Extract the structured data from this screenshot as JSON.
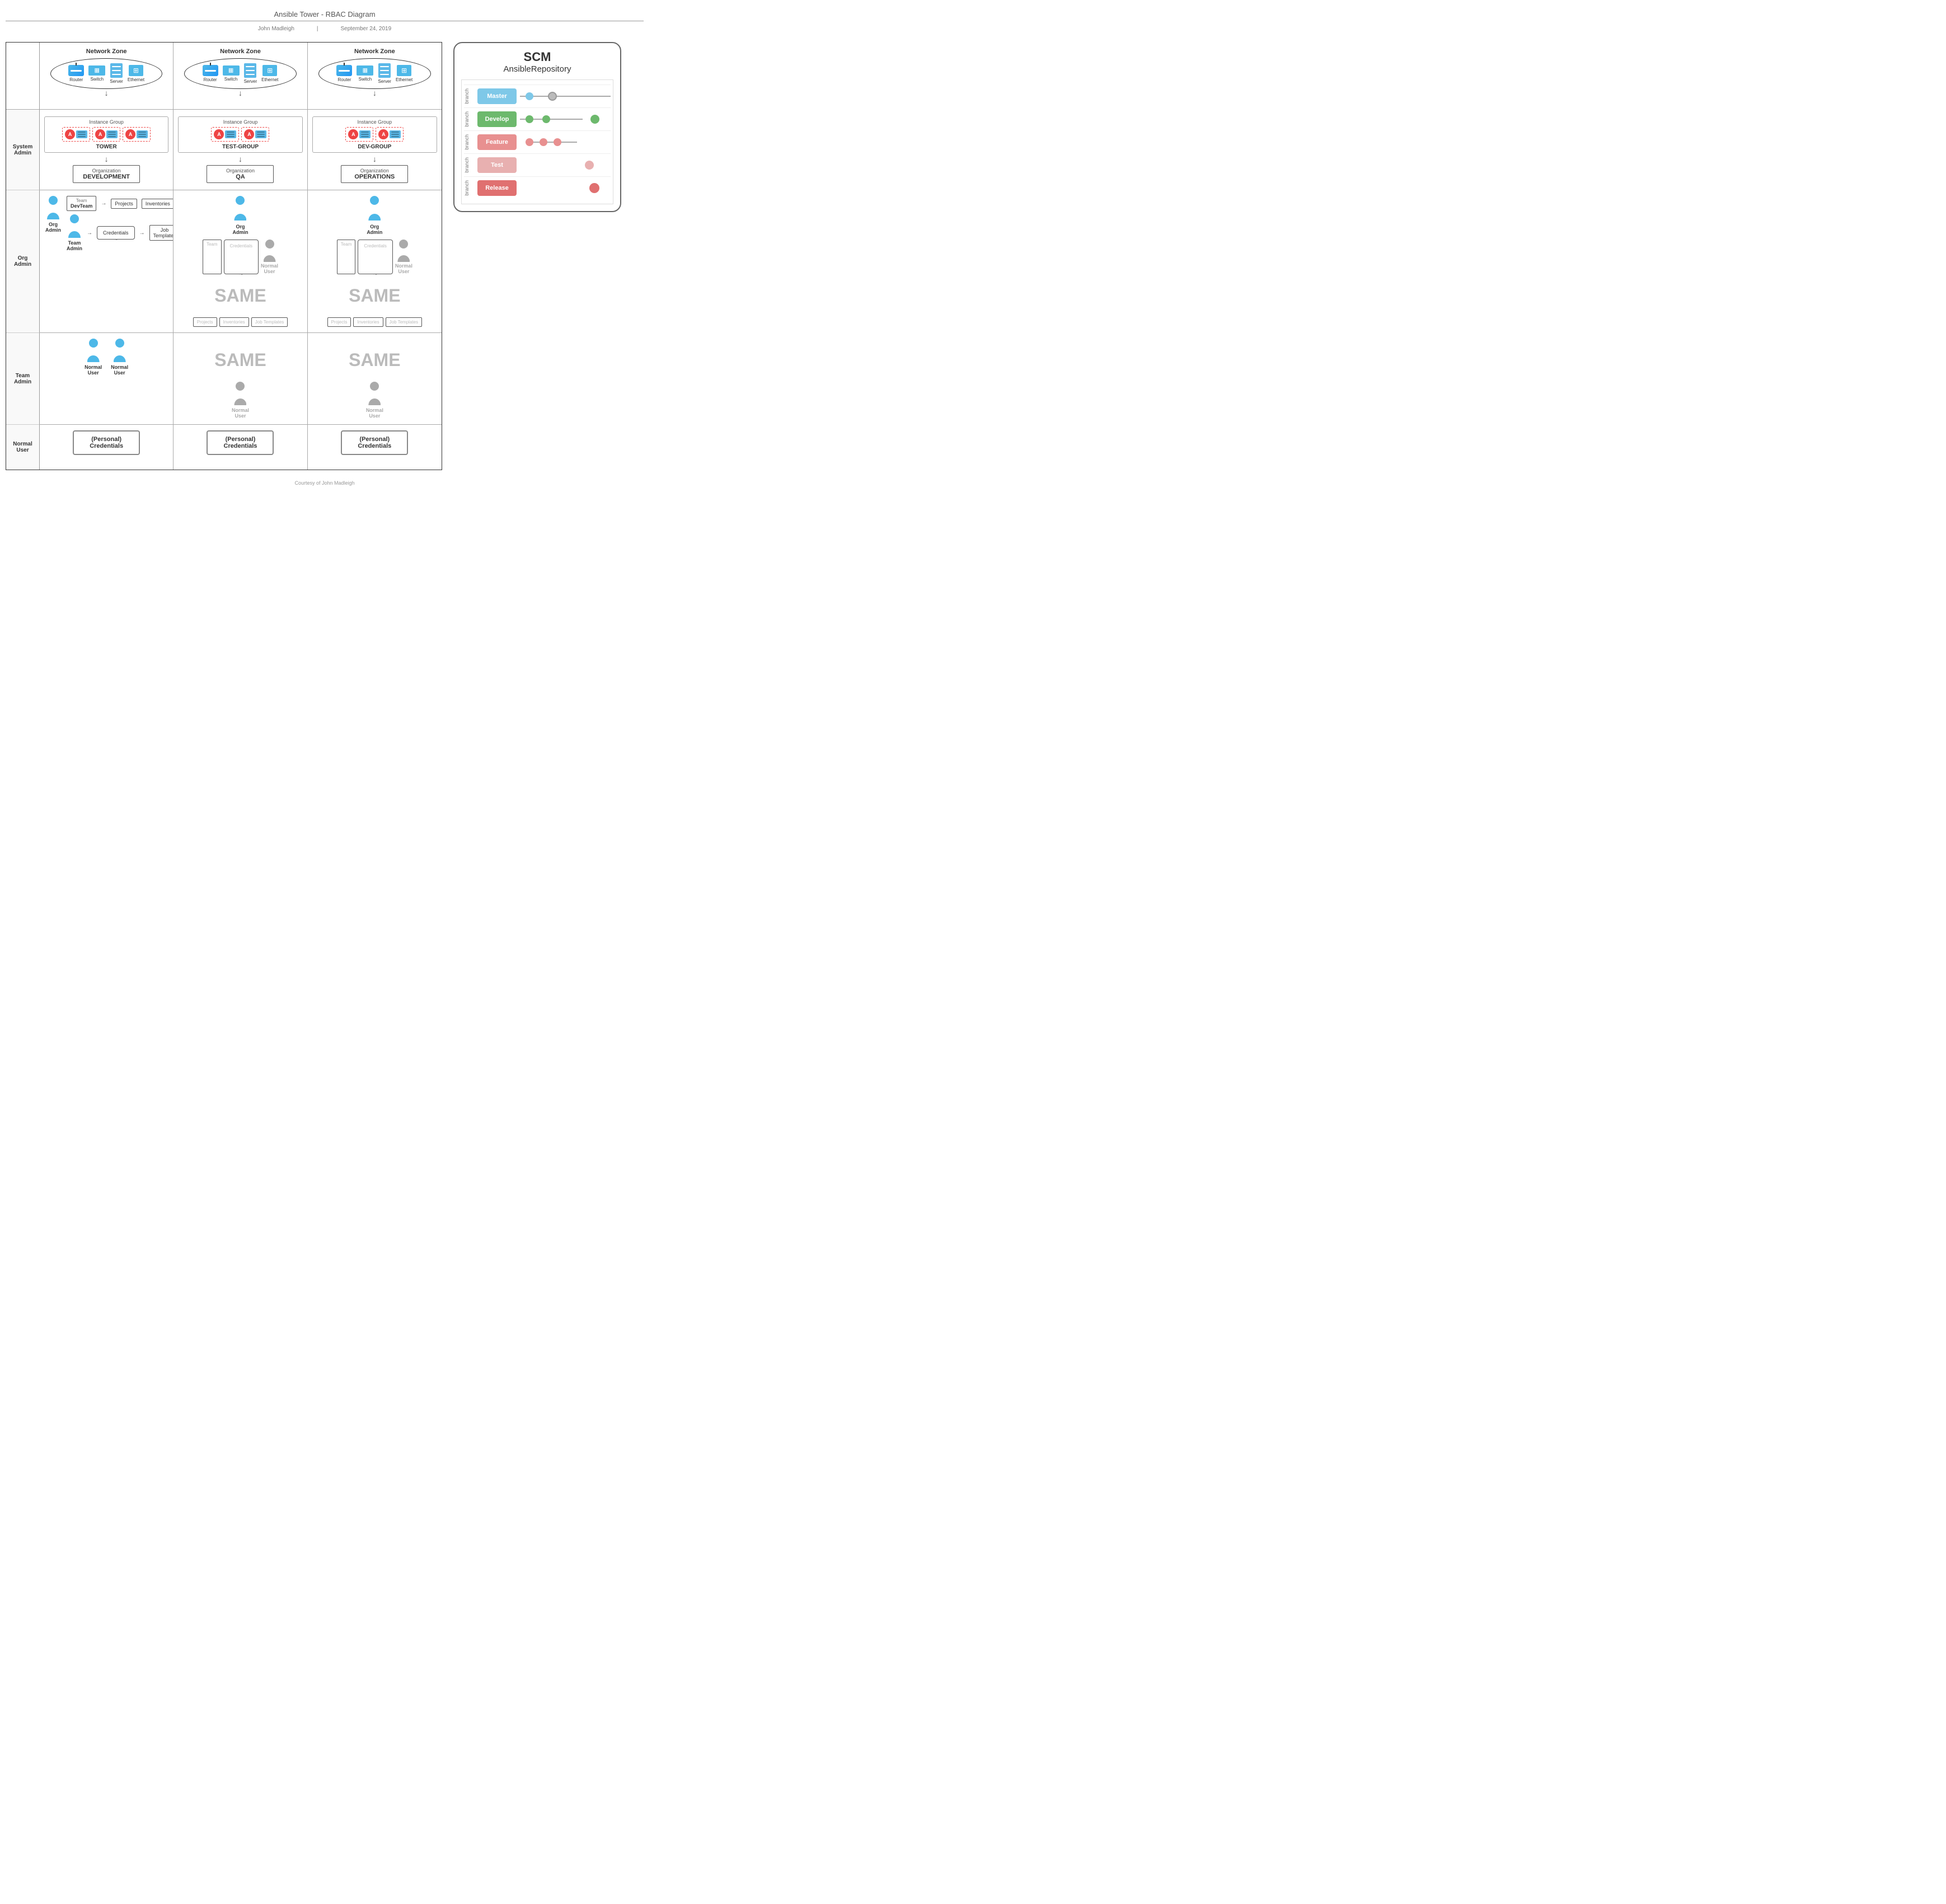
{
  "header": {
    "title": "Ansible Tower - RBAC Diagram",
    "author": "John Madleigh",
    "date": "September 24, 2019",
    "separator": "|"
  },
  "footer": {
    "text": "Courtesy of John Madleigh"
  },
  "row_labels": {
    "system_admin": "System\nAdmin",
    "org_admin": "Org\nAdmin",
    "team_admin": "Team\nAdmin",
    "normal_user": "Normal\nUser"
  },
  "network_zones": {
    "label": "Network Zone",
    "devices": {
      "router": "Router",
      "switch": "Switch",
      "server": "Server",
      "ethernet": "Ethernet"
    }
  },
  "instance_groups": {
    "tower": "TOWER",
    "test": "TEST-GROUP",
    "dev": "DEV-GROUP",
    "label": "Instance Group"
  },
  "organizations": {
    "development": "DEVELOPMENT",
    "qa": "QA",
    "operations": "OPERATIONS",
    "label": "Organization"
  },
  "roles": {
    "org_admin": "Org\nAdmin",
    "team_admin": "Team\nAdmin",
    "normal_user": "Normal\nUser"
  },
  "teams": {
    "dev_team": "DevTeam",
    "team_label": "Team"
  },
  "flow_items": {
    "projects": "Projects",
    "inventories": "Inventories",
    "credentials": "Credentials",
    "job_templates": "Job Templates",
    "personal_credentials": "(Personal)\nCredentials"
  },
  "same_label": "SAME",
  "scm": {
    "title": "SCM",
    "repo_title": "AnsibleRepository",
    "branch_label": "branch",
    "branches": [
      {
        "name": "Master",
        "color": "#7ec8e8",
        "id": "master"
      },
      {
        "name": "Develop",
        "color": "#6db96d",
        "id": "develop"
      },
      {
        "name": "Feature",
        "color": "#e89090",
        "id": "feature"
      },
      {
        "name": "Test",
        "color": "#e8b0b0",
        "id": "test"
      },
      {
        "name": "Release",
        "color": "#e07070",
        "id": "release"
      }
    ]
  }
}
